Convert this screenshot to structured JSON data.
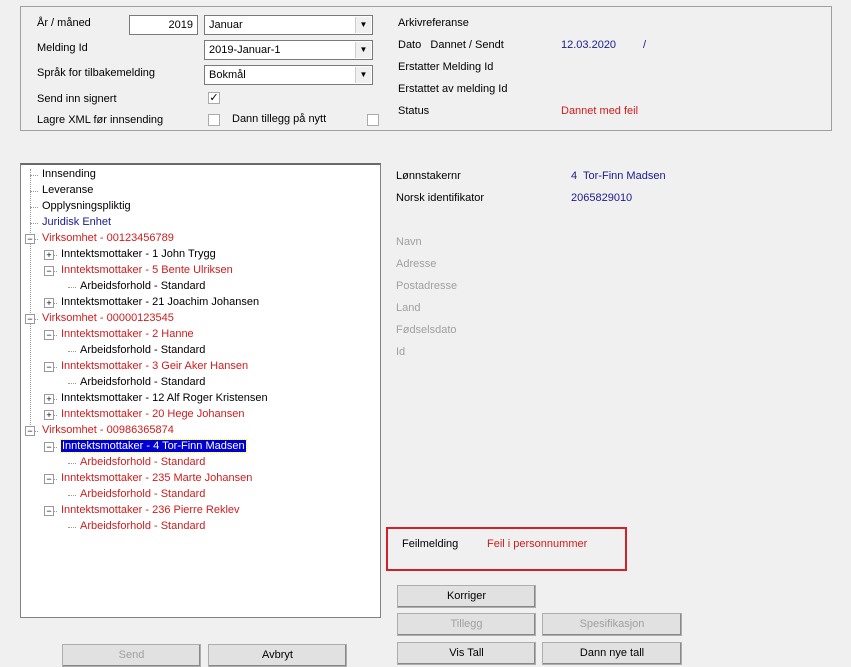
{
  "form": {
    "year_month_label": "År / måned",
    "year": "2019",
    "month": "Januar",
    "message_id_label": "Melding Id",
    "message_id": "2019-Januar-1",
    "language_label": "Språk for tilbakemelding",
    "language": "Bokmål",
    "send_signed_label": "Send inn signert",
    "send_signed": true,
    "save_xml_label": "Lagre XML før innsending",
    "save_xml": false,
    "recreate_label": "Dann tillegg på nytt",
    "recreate": false
  },
  "info": {
    "archive_label": "Arkivreferanse",
    "date_label": "Dato   Dannet / Sendt",
    "date_created": "12.03.2020",
    "date_sep": "/",
    "replaces_label": "Erstatter Melding Id",
    "replaced_by_label": "Erstattet av melding Id",
    "status_label": "Status",
    "status": "Dannet med feil"
  },
  "employee": {
    "nr_label": "Lønnstakernr",
    "nr": "4  Tor-Finn Madsen",
    "id_label": "Norsk identifikator",
    "id": "2065829010",
    "name_label": "Navn",
    "address_label": "Adresse",
    "postal_label": "Postadresse",
    "country_label": "Land",
    "birth_label": "Fødselsdato",
    "idfield_label": "Id"
  },
  "error": {
    "label": "Feilmelding",
    "message": "Feil i personnummer"
  },
  "tree": [
    {
      "label": "Innsending",
      "level": 0,
      "color": "black"
    },
    {
      "label": "Leveranse",
      "level": 0,
      "color": "black"
    },
    {
      "label": "Opplysningspliktig",
      "level": 0,
      "color": "black"
    },
    {
      "label": "Juridisk Enhet",
      "level": 0,
      "color": "blue"
    },
    {
      "label": "Virksomhet - 00123456789",
      "level": 0,
      "color": "red",
      "exp": "-"
    },
    {
      "label": "Inntektsmottaker - 1 John Trygg",
      "level": 1,
      "color": "black",
      "exp": "+"
    },
    {
      "label": "Inntektsmottaker - 5 Bente Ulriksen",
      "level": 1,
      "color": "red",
      "exp": "-"
    },
    {
      "label": "Arbeidsforhold - Standard",
      "level": 2,
      "color": "black"
    },
    {
      "label": "Inntektsmottaker - 21 Joachim Johansen",
      "level": 1,
      "color": "black",
      "exp": "+"
    },
    {
      "label": "Virksomhet - 00000123545",
      "level": 0,
      "color": "red",
      "exp": "-"
    },
    {
      "label": "Inntektsmottaker - 2 Hanne",
      "level": 1,
      "color": "red",
      "exp": "-"
    },
    {
      "label": "Arbeidsforhold - Standard",
      "level": 2,
      "color": "black"
    },
    {
      "label": "Inntektsmottaker - 3 Geir Aker Hansen",
      "level": 1,
      "color": "red",
      "exp": "-"
    },
    {
      "label": "Arbeidsforhold - Standard",
      "level": 2,
      "color": "black"
    },
    {
      "label": "Inntektsmottaker - 12 Alf Roger Kristensen",
      "level": 1,
      "color": "black",
      "exp": "+"
    },
    {
      "label": "Inntektsmottaker - 20 Hege Johansen",
      "level": 1,
      "color": "red",
      "exp": "+"
    },
    {
      "label": "Virksomhet - 00986365874",
      "level": 0,
      "color": "red",
      "exp": "-"
    },
    {
      "label": "Inntektsmottaker - 4 Tor-Finn Madsen",
      "level": 1,
      "color": "red",
      "exp": "-",
      "selected": true
    },
    {
      "label": "Arbeidsforhold - Standard",
      "level": 2,
      "color": "red"
    },
    {
      "label": "Inntektsmottaker - 235 Marte Johansen",
      "level": 1,
      "color": "red",
      "exp": "-"
    },
    {
      "label": "Arbeidsforhold - Standard",
      "level": 2,
      "color": "red"
    },
    {
      "label": "Inntektsmottaker - 236 Pierre Reklev",
      "level": 1,
      "color": "red",
      "exp": "-"
    },
    {
      "label": "Arbeidsforhold - Standard",
      "level": 2,
      "color": "red"
    }
  ],
  "buttons": {
    "korriger": "Korriger",
    "tillegg": "Tillegg",
    "spesifikasjon": "Spesifikasjon",
    "vis_tall": "Vis Tall",
    "dann_nye_tall": "Dann nye tall",
    "send": "Send",
    "avbryt": "Avbryt"
  },
  "colors": {
    "error": "#d01c1c",
    "value": "#1a1a8c",
    "selection": "#0000d0"
  }
}
